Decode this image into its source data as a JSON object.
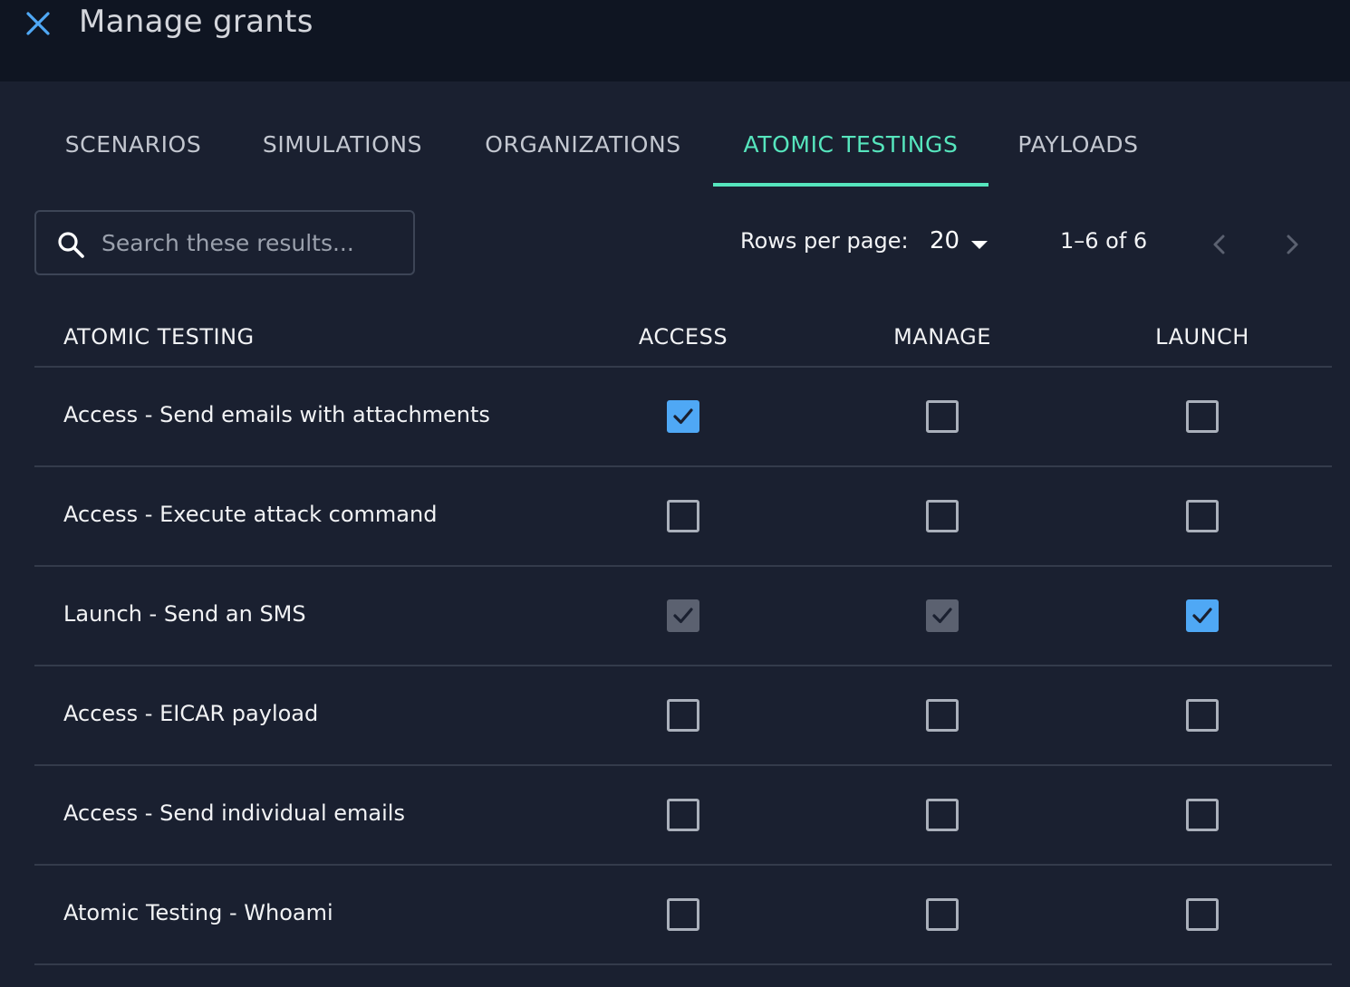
{
  "header": {
    "title": "Manage grants"
  },
  "tabs": [
    {
      "label": "SCENARIOS",
      "active": false
    },
    {
      "label": "SIMULATIONS",
      "active": false
    },
    {
      "label": "ORGANIZATIONS",
      "active": false
    },
    {
      "label": "ATOMIC TESTINGS",
      "active": true
    },
    {
      "label": "PAYLOADS",
      "active": false
    }
  ],
  "search": {
    "placeholder": "Search these results...",
    "value": ""
  },
  "pagination": {
    "rows_per_page_label": "Rows per page:",
    "rows_per_page_value": "20",
    "range": "1–6 of 6"
  },
  "table": {
    "columns": [
      "ATOMIC TESTING",
      "ACCESS",
      "MANAGE",
      "LAUNCH"
    ],
    "rows": [
      {
        "name": "Access - Send emails with attachments",
        "access": "checked",
        "manage": "unchecked",
        "launch": "unchecked"
      },
      {
        "name": "Access - Execute attack command",
        "access": "unchecked",
        "manage": "unchecked",
        "launch": "unchecked"
      },
      {
        "name": "Launch - Send an SMS",
        "access": "inherited",
        "manage": "inherited",
        "launch": "checked"
      },
      {
        "name": "Access - EICAR payload",
        "access": "unchecked",
        "manage": "unchecked",
        "launch": "unchecked"
      },
      {
        "name": "Access - Send individual emails",
        "access": "unchecked",
        "manage": "unchecked",
        "launch": "unchecked"
      },
      {
        "name": "Atomic Testing - Whoami",
        "access": "unchecked",
        "manage": "unchecked",
        "launch": "unchecked"
      }
    ]
  },
  "colors": {
    "accent_tab": "#56e5bd",
    "checkbox_checked": "#4fa8f5",
    "checkbox_inherited": "#5b6170",
    "close_icon": "#4fa8f5"
  },
  "icons": {
    "close": "close-icon",
    "search": "search-icon",
    "caret": "caret-down-icon",
    "prev": "chevron-left-icon",
    "next": "chevron-right-icon",
    "check": "check-icon"
  }
}
